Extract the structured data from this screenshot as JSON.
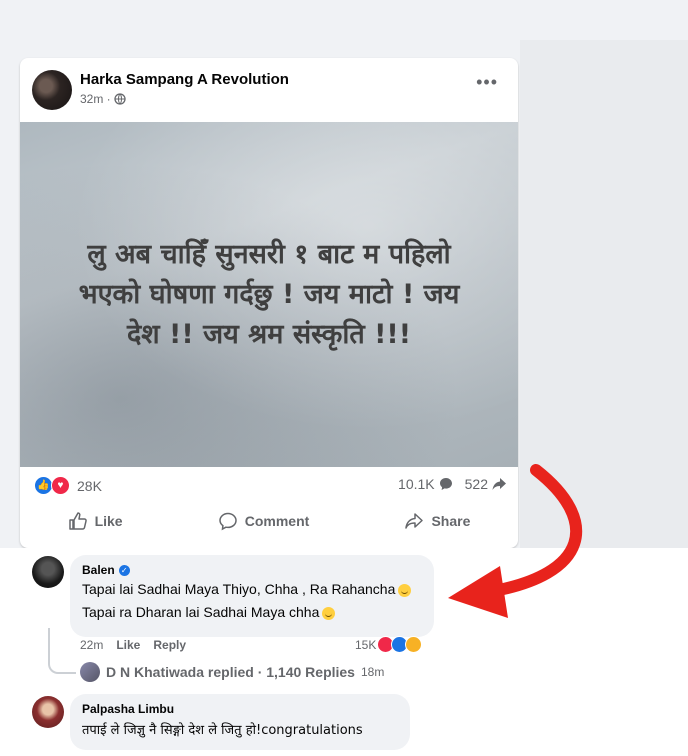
{
  "post": {
    "author": "Harka Sampang A Revolution",
    "time": "32m ·",
    "more": "•••",
    "image_text": "लु अब चाहिँ सुनसरी १ बाट म पहिलो भएको घोषणा गर्दछु ! जय माटो ! जय देश !! जय श्रम संस्कृति !!!",
    "reaction_count": "28K",
    "comment_count": "10.1K",
    "share_count": "522",
    "actions": {
      "like": "Like",
      "comment": "Comment",
      "share": "Share"
    }
  },
  "comments": [
    {
      "name": "Balen",
      "lines": [
        "Tapai lai Sadhai Maya Thiyo, Chha , Ra Rahancha",
        "Tapai ra Dharan lai Sadhai Maya chha"
      ],
      "time": "22m",
      "like": "Like",
      "reply": "Reply",
      "reactions": "15K"
    },
    {
      "name": "Palpasha Limbu",
      "lines": [
        "तपाई ले जिज्ञु नै सिङ्गो देश ले जितु हो!congratulations"
      ]
    }
  ],
  "replies": {
    "text": "D N Khatiwada replied · 1,140 Replies",
    "time": "18m"
  },
  "colors": {
    "accent_red": "#e8231c",
    "fb_blue": "#1b74e4"
  }
}
